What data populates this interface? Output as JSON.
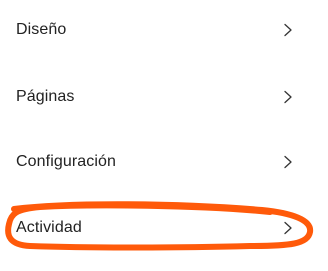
{
  "menu": {
    "items": [
      {
        "label": "Diseño",
        "icon": "chevron-right-icon"
      },
      {
        "label": "Páginas",
        "icon": "chevron-right-icon"
      },
      {
        "label": "Configuración",
        "icon": "chevron-right-icon"
      },
      {
        "label": "Actividad",
        "icon": "chevron-right-icon",
        "highlighted": true
      }
    ]
  },
  "colors": {
    "text": "#222222",
    "chevron": "#333333",
    "annotation": "#ff5a0a",
    "background": "#ffffff"
  }
}
